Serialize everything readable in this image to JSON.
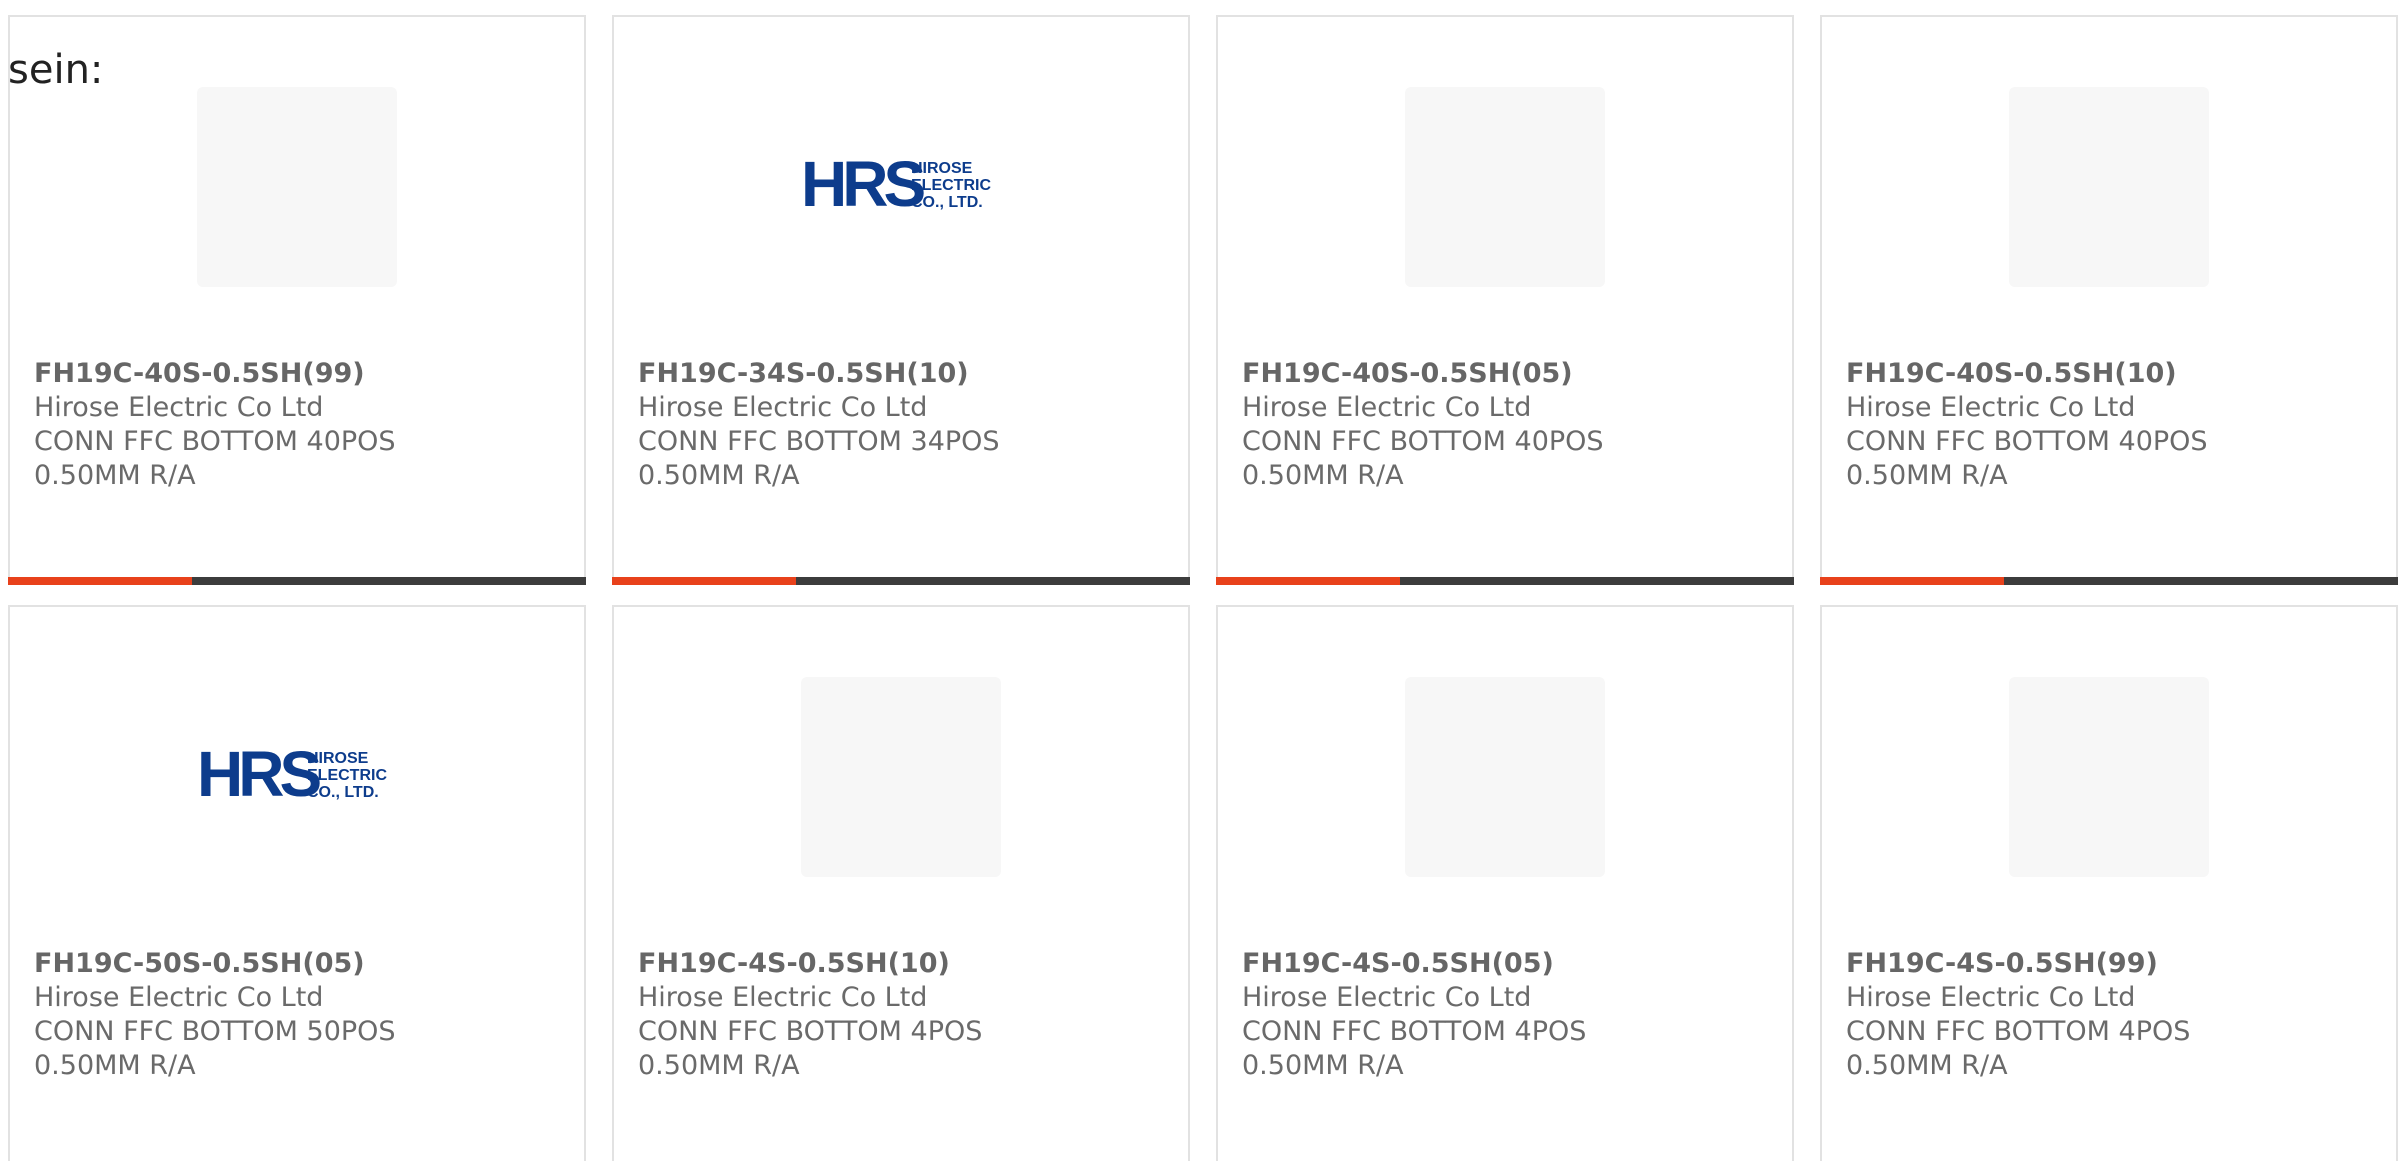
{
  "intro_text": "sein:",
  "colors": {
    "accent": "#e8411b",
    "bar": "#3c3c3c",
    "hrs_blue": "#0d3c8c"
  },
  "products": [
    {
      "part": "FH19C-40S-0.5SH(99)",
      "maker": "Hirose Electric Co Ltd",
      "desc1": "CONN FFC BOTTOM 40POS",
      "desc2": "0.50MM R/A",
      "image": "ffc-connector-strip"
    },
    {
      "part": "FH19C-34S-0.5SH(10)",
      "maker": "Hirose Electric Co Ltd",
      "desc1": "CONN FFC BOTTOM 34POS",
      "desc2": "0.50MM R/A",
      "image": "hrs-logo",
      "logo_mark": "HRS",
      "logo_lines": [
        "HIROSE",
        "ELECTRIC",
        "CO., LTD."
      ]
    },
    {
      "part": "FH19C-40S-0.5SH(05)",
      "maker": "Hirose Electric Co Ltd",
      "desc1": "CONN FFC BOTTOM 40POS",
      "desc2": "0.50MM R/A",
      "image": "ffc-connector-strip"
    },
    {
      "part": "FH19C-40S-0.5SH(10)",
      "maker": "Hirose Electric Co Ltd",
      "desc1": "CONN FFC BOTTOM 40POS",
      "desc2": "0.50MM R/A",
      "image": "ffc-connector-strip"
    },
    {
      "part": "FH19C-50S-0.5SH(05)",
      "maker": "Hirose Electric Co Ltd",
      "desc1": "CONN FFC BOTTOM 50POS",
      "desc2": "0.50MM R/A",
      "image": "hrs-logo",
      "logo_mark": "HRS",
      "logo_lines": [
        "HIROSE",
        "ELECTRIC",
        "CO., LTD."
      ]
    },
    {
      "part": "FH19C-4S-0.5SH(10)",
      "maker": "Hirose Electric Co Ltd",
      "desc1": "CONN FFC BOTTOM 4POS",
      "desc2": "0.50MM R/A",
      "image": "ffc-connector-pair"
    },
    {
      "part": "FH19C-4S-0.5SH(05)",
      "maker": "Hirose Electric Co Ltd",
      "desc1": "CONN FFC BOTTOM 4POS",
      "desc2": "0.50MM R/A",
      "image": "ffc-connector-pair"
    },
    {
      "part": "FH19C-4S-0.5SH(99)",
      "maker": "Hirose Electric Co Ltd",
      "desc1": "CONN FFC BOTTOM 4POS",
      "desc2": "0.50MM R/A",
      "image": "ffc-connector-pair"
    }
  ]
}
